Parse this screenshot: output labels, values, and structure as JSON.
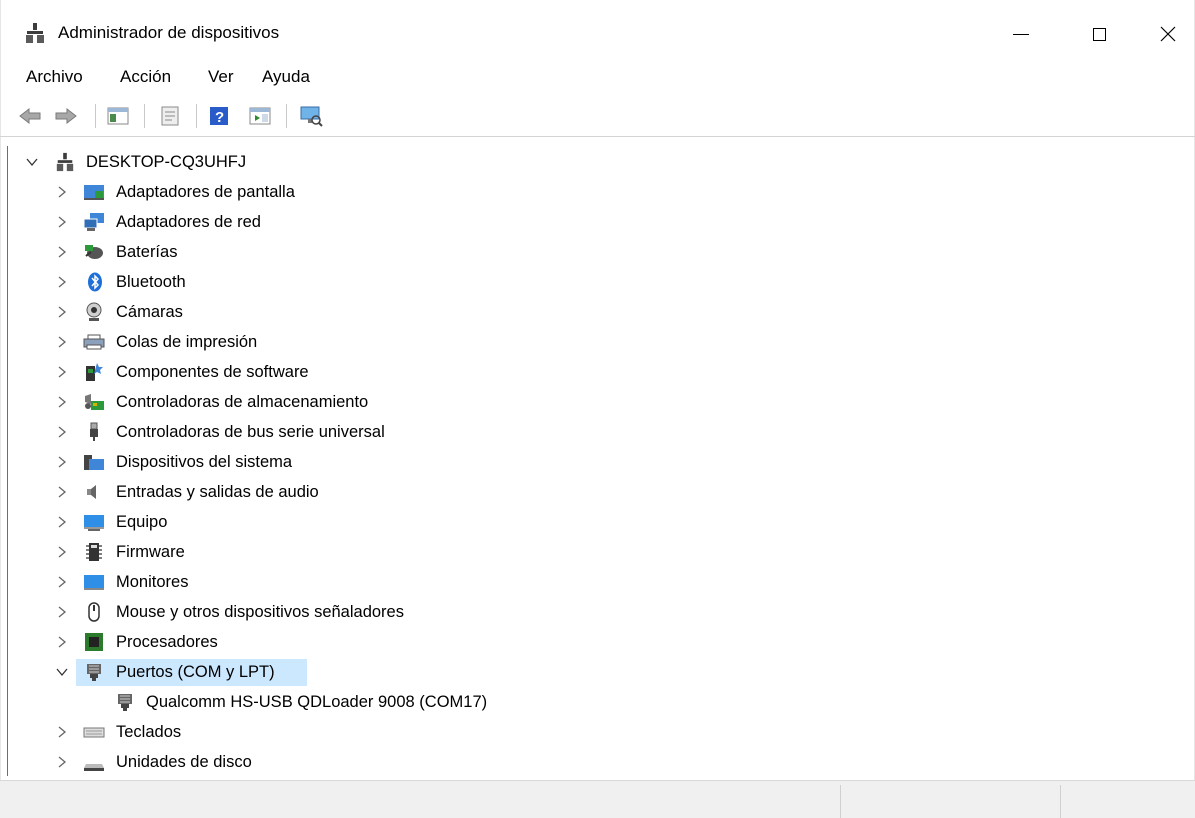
{
  "window": {
    "title": "Administrador de dispositivos",
    "controls": [
      "minimize-icon",
      "maximize-icon",
      "close-icon"
    ]
  },
  "menu": [
    "Archivo",
    "Acción",
    "Ver",
    "Ayuda"
  ],
  "toolbar": {
    "buttons": [
      "back-arrow-icon",
      "forward-arrow-icon",
      "show-hide-console-tree-icon",
      "properties-icon",
      "help-icon",
      "action-pane-icon",
      "scan-hardware-changes-icon"
    ]
  },
  "tree": {
    "root": "DESKTOP-CQ3UHFJ",
    "categories": [
      {
        "label": "Adaptadores de pantalla",
        "icon": "display-adapter-icon"
      },
      {
        "label": "Adaptadores de red",
        "icon": "network-adapter-icon"
      },
      {
        "label": "Baterías",
        "icon": "battery-icon"
      },
      {
        "label": "Bluetooth",
        "icon": "bluetooth-icon"
      },
      {
        "label": "Cámaras",
        "icon": "camera-icon"
      },
      {
        "label": "Colas de impresión",
        "icon": "printer-icon"
      },
      {
        "label": "Componentes de software",
        "icon": "software-component-icon"
      },
      {
        "label": "Controladoras de almacenamiento",
        "icon": "storage-controller-icon"
      },
      {
        "label": "Controladoras de bus serie universal",
        "icon": "usb-icon"
      },
      {
        "label": "Dispositivos del sistema",
        "icon": "system-devices-icon"
      },
      {
        "label": "Entradas y salidas de audio",
        "icon": "speaker-icon"
      },
      {
        "label": "Equipo",
        "icon": "computer-icon"
      },
      {
        "label": "Firmware",
        "icon": "firmware-chip-icon"
      },
      {
        "label": "Monitores",
        "icon": "monitor-icon"
      },
      {
        "label": "Mouse y otros dispositivos señaladores",
        "icon": "mouse-icon"
      },
      {
        "label": "Procesadores",
        "icon": "processor-icon"
      },
      {
        "label": "Puertos (COM y LPT)",
        "icon": "port-icon",
        "expanded": true,
        "selected": true,
        "children": [
          {
            "label": "Qualcomm HS-USB QDLoader 9008 (COM17)",
            "icon": "port-icon"
          }
        ]
      },
      {
        "label": "Teclados",
        "icon": "keyboard-icon"
      },
      {
        "label": "Unidades de disco",
        "icon": "disk-drive-icon"
      }
    ]
  },
  "colors": {
    "selection": "#cce8ff",
    "status_bar": "#f0f0f0"
  }
}
